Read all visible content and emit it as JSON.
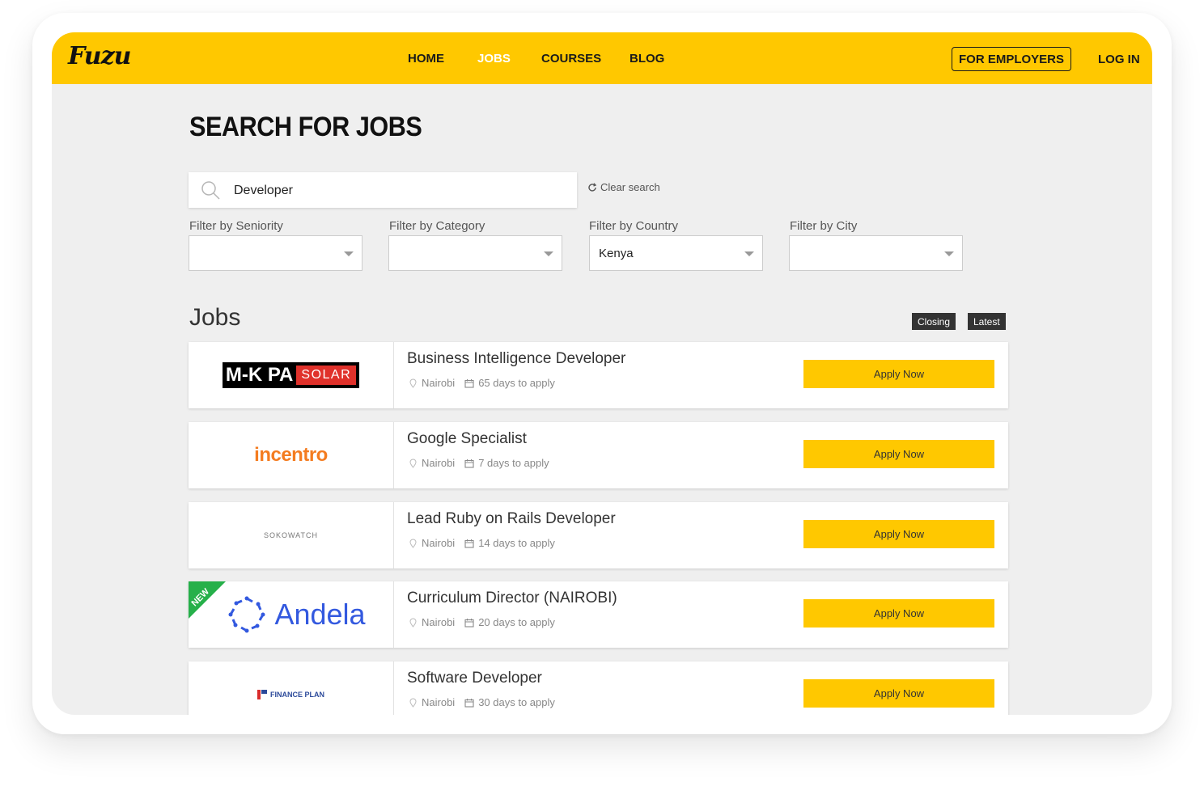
{
  "brand": {
    "logo_text": "Fuzu",
    "accent_color": "#ffc800",
    "new_badge_color": "#26b04a"
  },
  "nav": {
    "links": [
      {
        "label": "HOME",
        "active": false
      },
      {
        "label": "JOBS",
        "active": true
      },
      {
        "label": "COURSES",
        "active": false
      },
      {
        "label": "BLOG",
        "active": false
      }
    ],
    "employers_label": "FOR EMPLOYERS",
    "login_label": "LOG IN"
  },
  "page": {
    "title": "SEARCH FOR JOBS"
  },
  "search": {
    "value": "Developer",
    "icon": "search-icon",
    "clear_label": "Clear search"
  },
  "filters": [
    {
      "label": "Filter by Seniority",
      "value": ""
    },
    {
      "label": "Filter by Category",
      "value": ""
    },
    {
      "label": "Filter by Country",
      "value": "Kenya"
    },
    {
      "label": "Filter by City",
      "value": ""
    }
  ],
  "jobs": {
    "heading": "Jobs",
    "sort": {
      "closing_label": "Closing",
      "latest_label": "Latest"
    },
    "apply_label": "Apply Now",
    "new_label": "NEW",
    "items": [
      {
        "title": "Business Intelligence Developer",
        "location": "Nairobi",
        "deadline": "65 days to apply",
        "company_logo": "M-K PA",
        "company_logo_sub": "SOLAR"
      },
      {
        "title": "Google Specialist",
        "location": "Nairobi",
        "deadline": "7 days to apply",
        "company_logo": "incentro"
      },
      {
        "title": "Lead Ruby on Rails Developer",
        "location": "Nairobi",
        "deadline": "14 days to apply",
        "company_logo": "SOKOWATCH"
      },
      {
        "title": "Curriculum Director (NAIROBI)",
        "location": "Nairobi",
        "deadline": "20 days to apply",
        "company_logo": "Andela",
        "is_new": true
      },
      {
        "title": "Software Developer",
        "location": "Nairobi",
        "deadline": "30 days to apply",
        "company_logo": "FINANCE PLAN"
      }
    ]
  }
}
